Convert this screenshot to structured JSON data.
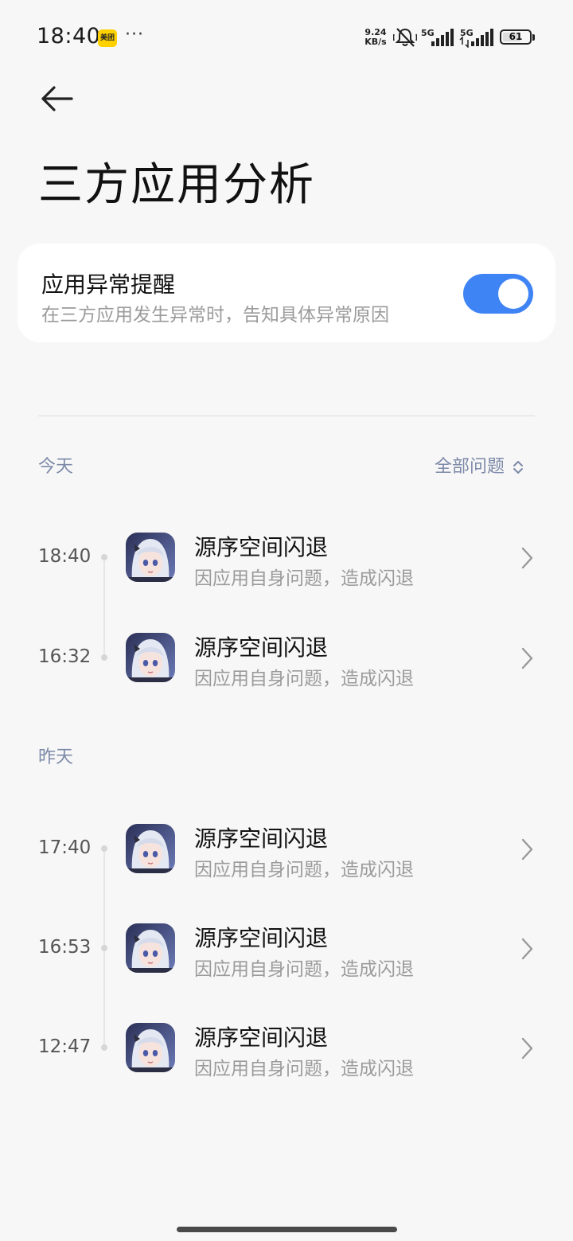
{
  "status_bar": {
    "time": "18:40",
    "notification_app": "美团",
    "more_dots": "···",
    "net_speed_value": "9.24",
    "net_speed_unit": "KB/s",
    "signal1_label": "5G",
    "signal2_label": "5G",
    "battery_level": "61"
  },
  "header": {
    "back_icon": "back-arrow-icon",
    "title": "三方应用分析"
  },
  "alert_card": {
    "title": "应用异常提醒",
    "subtitle": "在三方应用发生异常时，告知具体异常原因",
    "toggle_on": true,
    "accent_color": "#3f84f4"
  },
  "filter": {
    "label": "全部问题"
  },
  "sections": [
    {
      "label": "今天",
      "items": [
        {
          "time": "18:40",
          "app_name": "源序空间闪退",
          "reason": "因应用自身问题，造成闪退"
        },
        {
          "time": "16:32",
          "app_name": "源序空间闪退",
          "reason": "因应用自身问题，造成闪退"
        }
      ]
    },
    {
      "label": "昨天",
      "items": [
        {
          "time": "17:40",
          "app_name": "源序空间闪退",
          "reason": "因应用自身问题，造成闪退"
        },
        {
          "time": "16:53",
          "app_name": "源序空间闪退",
          "reason": "因应用自身问题，造成闪退"
        },
        {
          "time": "12:47",
          "app_name": "源序空间闪退",
          "reason": "因应用自身问题，造成闪退"
        }
      ]
    }
  ]
}
